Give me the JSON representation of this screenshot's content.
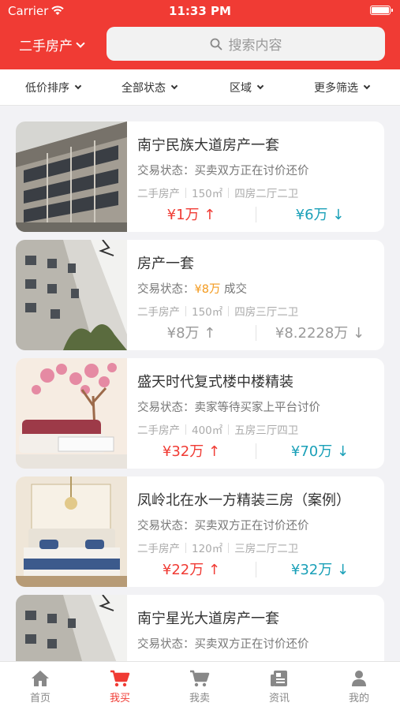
{
  "status_bar": {
    "carrier": "Carrier",
    "time": "11:33 PM"
  },
  "header": {
    "city": "二手房产",
    "search_placeholder": "搜索内容"
  },
  "filters": [
    {
      "label": "低价排序"
    },
    {
      "label": "全部状态"
    },
    {
      "label": "区域"
    },
    {
      "label": "更多筛选"
    }
  ],
  "listings": [
    {
      "title": "南宁民族大道房产一套",
      "status_label": "交易状态：",
      "status_value": "买卖双方正在讨价还价",
      "status_price": "",
      "status_suffix": "",
      "type": "二手房产",
      "area": "150㎡",
      "layout": "四房二厅二卫",
      "price_up": "¥1万 ↑",
      "price_down": "¥6万 ↓",
      "state": "active"
    },
    {
      "title": "房产一套",
      "status_label": "交易状态：",
      "status_value": "",
      "status_price": "¥8万",
      "status_suffix": " 成交",
      "type": "二手房产",
      "area": "150㎡",
      "layout": "四房三厅二卫",
      "price_up": "¥8万 ↑",
      "price_down": "¥8.2228万 ↓",
      "state": "closed"
    },
    {
      "title": "盛天时代复式楼中楼精装",
      "status_label": "交易状态：",
      "status_value": "卖家等待买家上平台讨价",
      "status_price": "",
      "status_suffix": "",
      "type": "二手房产",
      "area": "400㎡",
      "layout": "五房三厅四卫",
      "price_up": "¥32万 ↑",
      "price_down": "¥70万 ↓",
      "state": "active"
    },
    {
      "title": "凤岭北在水一方精装三房（案例）",
      "status_label": "交易状态：",
      "status_value": "买卖双方正在讨价还价",
      "status_price": "",
      "status_suffix": "",
      "type": "二手房产",
      "area": "120㎡",
      "layout": "三房二厅二卫",
      "price_up": "¥22万 ↑",
      "price_down": "¥32万 ↓",
      "state": "active"
    },
    {
      "title": "南宁星光大道房产一套",
      "status_label": "交易状态：",
      "status_value": "买卖双方正在讨价还价",
      "status_price": "",
      "status_suffix": "",
      "type": "二手房产",
      "area": "",
      "layout": "",
      "price_up": "",
      "price_down": "",
      "state": "active"
    }
  ],
  "tabs": [
    {
      "label": "首页",
      "icon": "home-icon"
    },
    {
      "label": "我买",
      "icon": "cart-icon"
    },
    {
      "label": "我卖",
      "icon": "cart-icon"
    },
    {
      "label": "资讯",
      "icon": "news-icon"
    },
    {
      "label": "我的",
      "icon": "user-icon"
    }
  ],
  "colors": {
    "brand_red": "#f03b34",
    "price_up": "#f03b34",
    "price_down": "#1aa0b8",
    "highlight_orange": "#f39a1e"
  }
}
